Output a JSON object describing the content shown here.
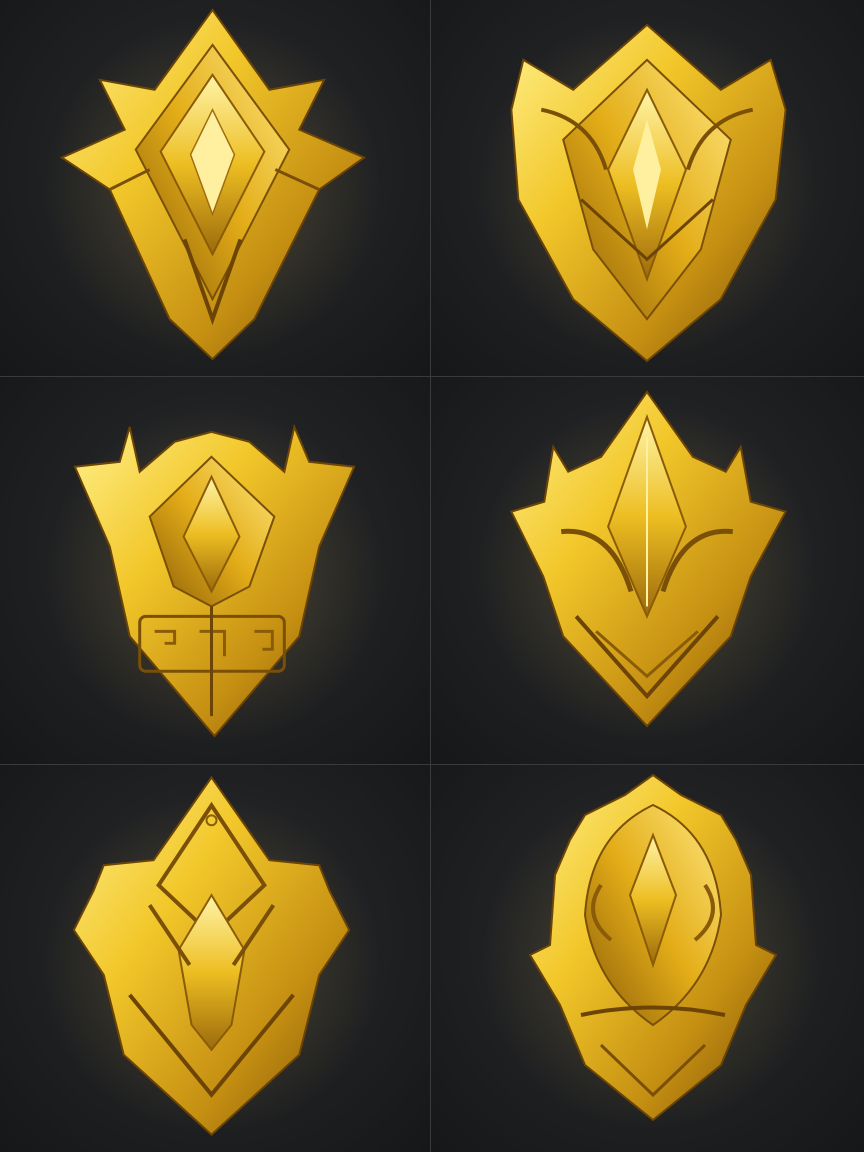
{
  "sheet": {
    "layout": "3x2 grid",
    "background_color": "#1f2022",
    "badges": [
      {
        "icon": "gold-spiked-shield-emblem-icon",
        "variant": "spiked crown shield"
      },
      {
        "icon": "gold-winged-shield-emblem-icon",
        "variant": "winged shield"
      },
      {
        "icon": "gold-horned-crest-emblem-icon",
        "variant": "horned crest with engraved panel"
      },
      {
        "icon": "gold-faceted-shield-emblem-icon",
        "variant": "faceted angular shield"
      },
      {
        "icon": "gold-diamond-crest-emblem-icon",
        "variant": "diamond crest"
      },
      {
        "icon": "gold-ornate-shield-emblem-icon",
        "variant": "ornate rounded shield"
      }
    ],
    "colors": {
      "gold_light": "#ffe36a",
      "gold_mid": "#e8b81e",
      "gold_dark": "#9a6a0a",
      "gold_shadow": "#5c3c05"
    }
  }
}
